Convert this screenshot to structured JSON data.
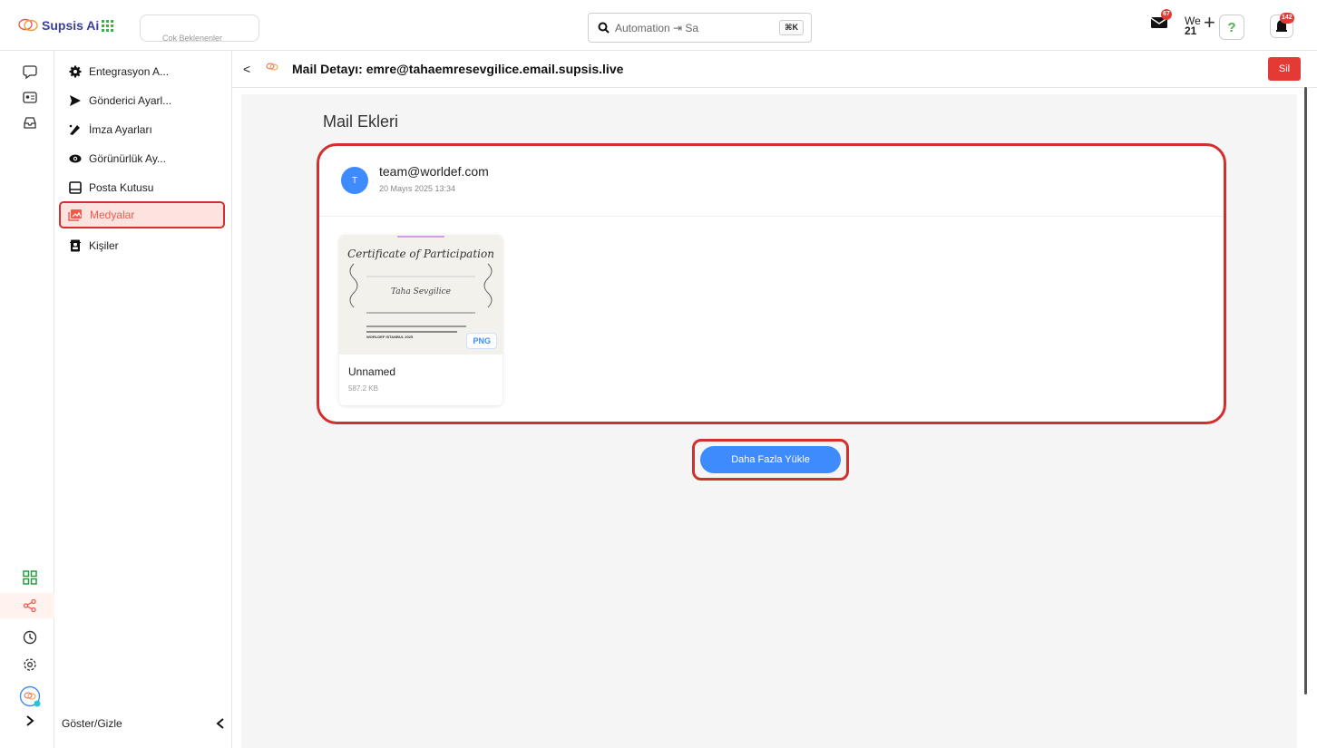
{
  "app": {
    "brand_name": "Supsis Ai",
    "tab_pill_label": "Çok Beklenenler",
    "brand_color": "#3a3fa0",
    "accent_color": "#ef5b4b"
  },
  "search": {
    "placeholder": "Automation ⇥ Sa",
    "shortcut": "⌘K"
  },
  "top_right": {
    "mail_badge": "67",
    "date_weekday": "We",
    "date_day": "21",
    "plus_label": "+",
    "help_label": "?",
    "notification_badge": "142"
  },
  "rail": {
    "icons": [
      "chat-bubble-icon",
      "contact-card-icon",
      "inbox-tray-icon",
      "grid-icon",
      "share-nodes-icon",
      "clock-icon",
      "settings-gear-icon",
      "supsis-avatar-icon",
      "chevron-right-icon"
    ]
  },
  "sidebar": {
    "items": [
      {
        "label": "Entegrasyon A...",
        "icon": "gear-icon"
      },
      {
        "label": "Gönderici Ayarl...",
        "icon": "send-icon"
      },
      {
        "label": "İmza Ayarları",
        "icon": "signature-icon"
      },
      {
        "label": "Görünürlük Ay...",
        "icon": "eye-icon"
      },
      {
        "label": "Posta Kutusu",
        "icon": "mailbox-icon"
      },
      {
        "label": "Medyalar",
        "icon": "media-icon"
      },
      {
        "label": "Kişiler",
        "icon": "contacts-icon"
      }
    ],
    "footer_label": "Göster/Gizle"
  },
  "header": {
    "back": "<",
    "mini_logo_text": "Supsis Ai",
    "title": "Mail Detayı: emre@tahaemresevgilice.email.supsis.live",
    "delete_label": "Sil"
  },
  "main": {
    "section_title": "Mail Ekleri",
    "sender": {
      "avatar_letter": "T",
      "email": "team@worldef.com",
      "date": "20 Mayıs 2025 13:34"
    },
    "attachments": [
      {
        "name": "Unnamed",
        "size": "587.2 KB",
        "type": "PNG",
        "thumb_title": "Certificate of Participation",
        "thumb_name": "Taha Sevgilice",
        "thumb_footer": "WORLDEF ISTANBUL 2025"
      }
    ],
    "load_more_label": "Daha Fazla Yükle"
  }
}
